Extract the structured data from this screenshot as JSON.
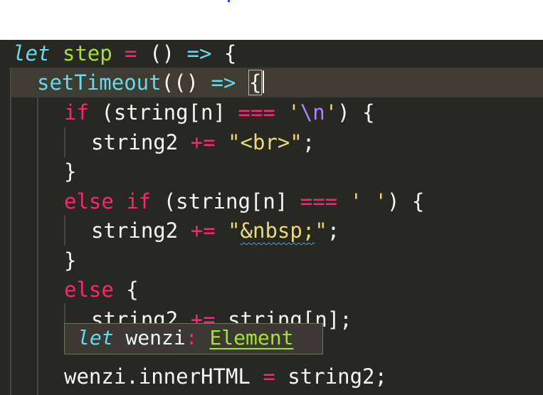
{
  "editor": {
    "colors": {
      "background": "#272822",
      "current_line": "#3e3d32",
      "keyword": "#66d9ef",
      "operator": "#f92672",
      "function": "#a6e22e",
      "string": "#e6db74",
      "escape": "#ae81ff",
      "default": "#f8f8f2"
    },
    "lines": [
      {
        "tokens": [
          "let",
          " ",
          "step",
          " ",
          "=",
          " ",
          "()",
          " ",
          "=>",
          " ",
          "{"
        ]
      },
      {
        "tokens": [
          "setTimeout",
          "(",
          "()",
          " ",
          "=>",
          " ",
          "{"
        ]
      },
      {
        "tokens": [
          "if",
          " (string[n] ",
          "===",
          " ",
          "'",
          "\\n",
          "'",
          ") {"
        ]
      },
      {
        "tokens": [
          "string2 ",
          "+=",
          " ",
          "\"<br>\"",
          ";"
        ]
      },
      {
        "tokens": [
          "}"
        ]
      },
      {
        "tokens": [
          "else",
          " ",
          "if",
          " (string[n] ",
          "===",
          " ",
          "' '",
          ") {"
        ]
      },
      {
        "tokens": [
          "string2 ",
          "+=",
          " ",
          "\"",
          "&nbsp;",
          "\"",
          ";"
        ]
      },
      {
        "tokens": [
          "}"
        ]
      },
      {
        "tokens": [
          "else",
          " {"
        ]
      },
      {
        "tokens": [
          "string2 ",
          "+=",
          " string[n];"
        ]
      },
      {
        "tokens": [
          "wenzi.innerHTML ",
          "=",
          " string2;"
        ]
      }
    ]
  },
  "tooltip": {
    "keyword": "let",
    "name": " wenzi",
    "colon": ":",
    "type": "Element",
    "icon": "type-hint"
  }
}
